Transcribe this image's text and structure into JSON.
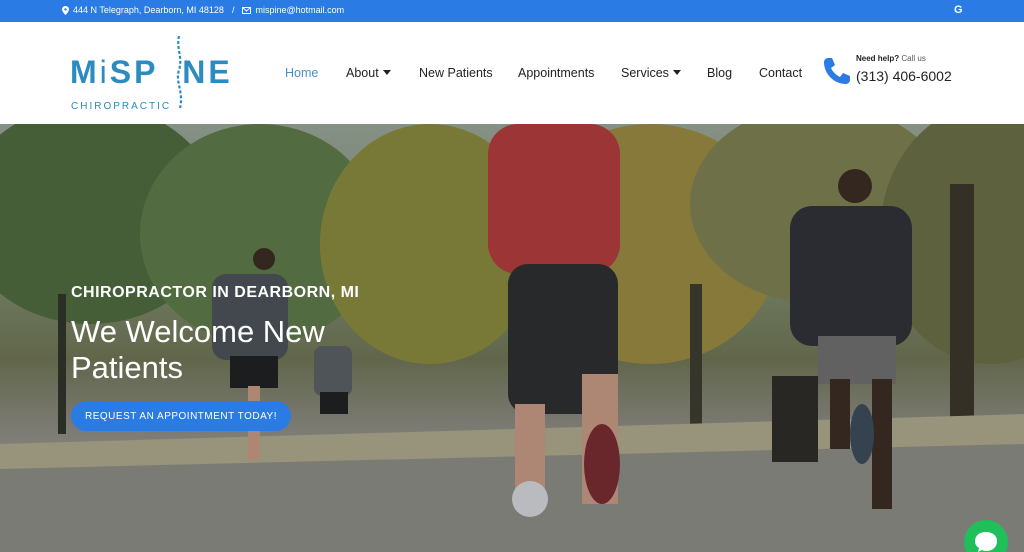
{
  "topbar": {
    "address": "444 N Telegraph, Dearborn, MI 48128",
    "separator": "/",
    "email": "mispine@hotmail.com",
    "google_letter": "G"
  },
  "logo": {
    "main": "MiSP NE",
    "sub": "CHIROPRACTIC"
  },
  "nav": {
    "items": [
      {
        "label": "Home"
      },
      {
        "label": "About"
      },
      {
        "label": "New Patients"
      },
      {
        "label": "Appointments"
      },
      {
        "label": "Services"
      },
      {
        "label": "Blog"
      },
      {
        "label": "Contact"
      }
    ]
  },
  "help": {
    "need": "Need help?",
    "call": "Call us",
    "phone": "(313) 406-6002"
  },
  "hero": {
    "kicker": "CHIROPRACTOR IN DEARBORN, MI",
    "title": "We Welcome New Patients",
    "cta": "REQUEST AN APPOINTMENT TODAY!"
  },
  "colors": {
    "accent": "#2a7be4",
    "brand": "#2c8bc0",
    "chat": "#1fbf5a"
  }
}
